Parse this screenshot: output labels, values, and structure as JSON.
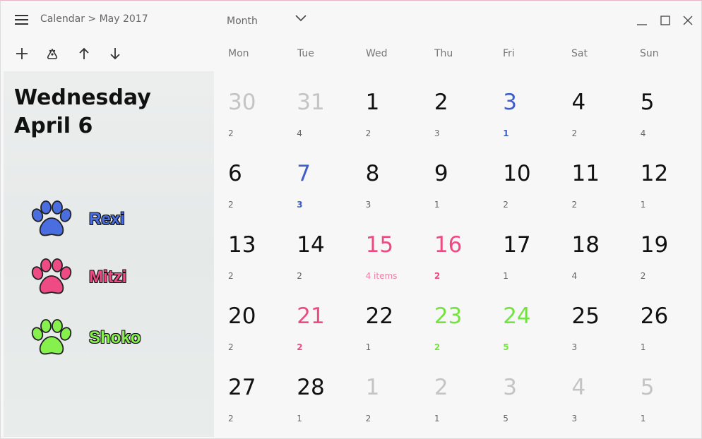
{
  "header": {
    "breadcrumb": "Calendar > May 2017",
    "view_label": "Month"
  },
  "toolbar": {
    "icons": [
      "plus-icon",
      "paw-icon",
      "arrow-up-icon",
      "arrow-down-icon"
    ]
  },
  "weekdays": [
    "Mon",
    "Tue",
    "Wed",
    "Thu",
    "Fri",
    "Sat",
    "Sun"
  ],
  "selected_date": {
    "weekday": "Wednesday",
    "date": "April 6"
  },
  "pets": [
    {
      "name": "Rexi",
      "color": "#4a6ee0"
    },
    {
      "name": "Mitzi",
      "color": "#ee4b84"
    },
    {
      "name": "Shoko",
      "color": "#86f04c"
    }
  ],
  "colors": {
    "blue": "#3f5ec9",
    "pink": "#ee4b84",
    "green": "#74e342",
    "muted": "#c4c4c4"
  },
  "weeks": [
    [
      {
        "day": "30",
        "count": "2",
        "style": "muted"
      },
      {
        "day": "31",
        "count": "4",
        "style": "muted"
      },
      {
        "day": "1",
        "count": "2",
        "style": "dark"
      },
      {
        "day": "2",
        "count": "3",
        "style": "dark"
      },
      {
        "day": "3",
        "count": "1",
        "style": "blue"
      },
      {
        "day": "4",
        "count": "2",
        "style": "dark"
      },
      {
        "day": "5",
        "count": "4",
        "style": "dark"
      }
    ],
    [
      {
        "day": "6",
        "count": "2",
        "style": "dark"
      },
      {
        "day": "7",
        "count": "3",
        "style": "blue"
      },
      {
        "day": "8",
        "count": "3",
        "style": "dark"
      },
      {
        "day": "9",
        "count": "1",
        "style": "dark"
      },
      {
        "day": "10",
        "count": "2",
        "style": "dark"
      },
      {
        "day": "11",
        "count": "2",
        "style": "dark"
      },
      {
        "day": "12",
        "count": "1",
        "style": "dark"
      }
    ],
    [
      {
        "day": "13",
        "count": "2",
        "style": "dark"
      },
      {
        "day": "14",
        "count": "2",
        "style": "dark"
      },
      {
        "day": "15",
        "count": "4 items",
        "style": "pink-light"
      },
      {
        "day": "16",
        "count": "2",
        "style": "pink"
      },
      {
        "day": "17",
        "count": "1",
        "style": "dark"
      },
      {
        "day": "18",
        "count": "4",
        "style": "dark"
      },
      {
        "day": "19",
        "count": "2",
        "style": "dark"
      }
    ],
    [
      {
        "day": "20",
        "count": "2",
        "style": "dark"
      },
      {
        "day": "21",
        "count": "2",
        "style": "pink"
      },
      {
        "day": "22",
        "count": "1",
        "style": "dark"
      },
      {
        "day": "23",
        "count": "2",
        "style": "green"
      },
      {
        "day": "24",
        "count": "5",
        "style": "green"
      },
      {
        "day": "25",
        "count": "3",
        "style": "dark"
      },
      {
        "day": "26",
        "count": "1",
        "style": "dark"
      }
    ],
    [
      {
        "day": "27",
        "count": "2",
        "style": "dark"
      },
      {
        "day": "28",
        "count": "1",
        "style": "dark"
      },
      {
        "day": "1",
        "count": "2",
        "style": "muted"
      },
      {
        "day": "2",
        "count": "1",
        "style": "muted"
      },
      {
        "day": "3",
        "count": "5",
        "style": "muted"
      },
      {
        "day": "4",
        "count": "3",
        "style": "muted"
      },
      {
        "day": "5",
        "count": "1",
        "style": "muted"
      }
    ]
  ]
}
